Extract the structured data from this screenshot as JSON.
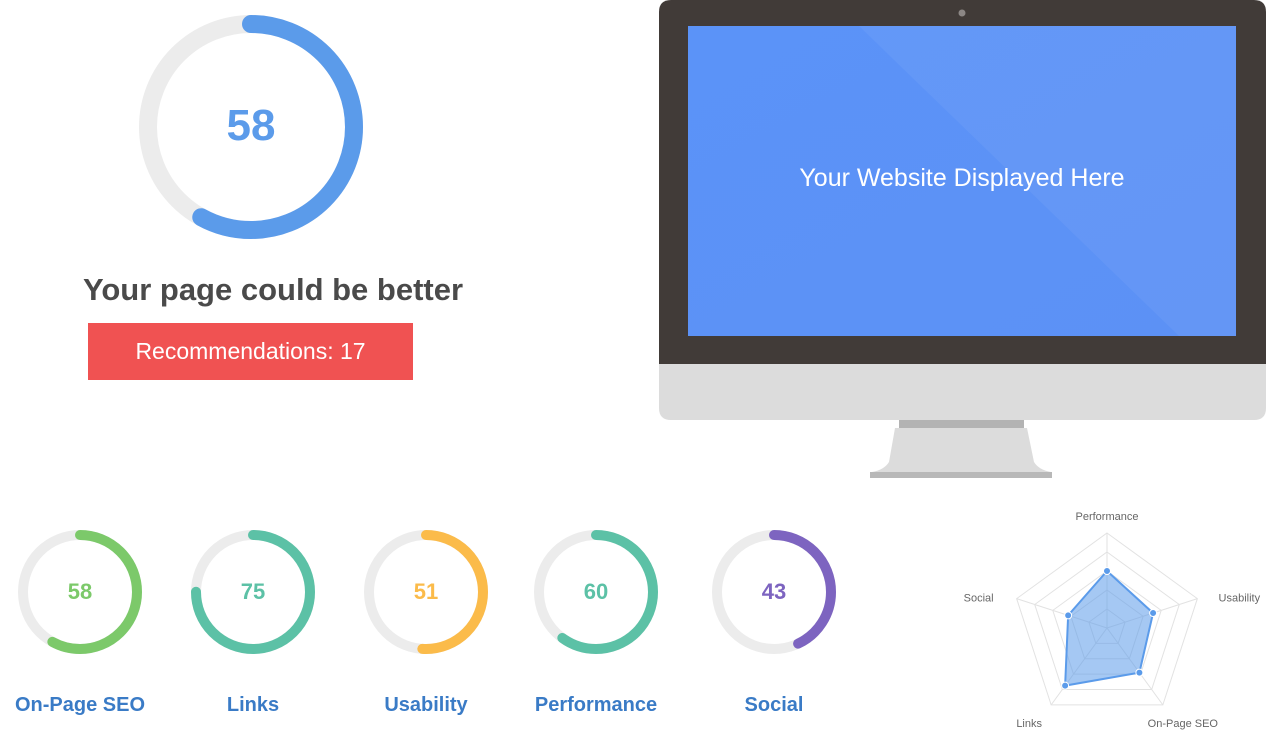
{
  "summary": {
    "score": "58",
    "score_value": 58,
    "verdict": "Your page could be better",
    "recommendations": "Recommendations: 17"
  },
  "monitor": {
    "screen_text": "Your Website Displayed Here"
  },
  "categories": [
    {
      "label": "On-Page SEO",
      "score": "58",
      "value": 58,
      "color": "#7cc96a"
    },
    {
      "label": "Links",
      "score": "75",
      "value": 75,
      "color": "#5cc1a6"
    },
    {
      "label": "Usability",
      "score": "51",
      "value": 51,
      "color": "#fbbb4a"
    },
    {
      "label": "Performance",
      "score": "60",
      "value": 60,
      "color": "#5cc1a6"
    },
    {
      "label": "Social",
      "score": "43",
      "value": 43,
      "color": "#7d64c0"
    }
  ],
  "colors": {
    "primary_blue": "#5b9bea",
    "track_gray": "#ececec",
    "recommend_red": "#f05252",
    "label_blue": "#3a7bc6",
    "screen_blue": "#5b93f8",
    "bezel_dark": "#413b38"
  },
  "chart_data": {
    "type": "radar",
    "axes": [
      "Performance",
      "Usability",
      "On-Page SEO",
      "Links",
      "Social"
    ],
    "values": [
      60,
      51,
      58,
      75,
      43
    ],
    "range": [
      0,
      100
    ],
    "grid": true,
    "fill_color": "#5b9bea"
  }
}
